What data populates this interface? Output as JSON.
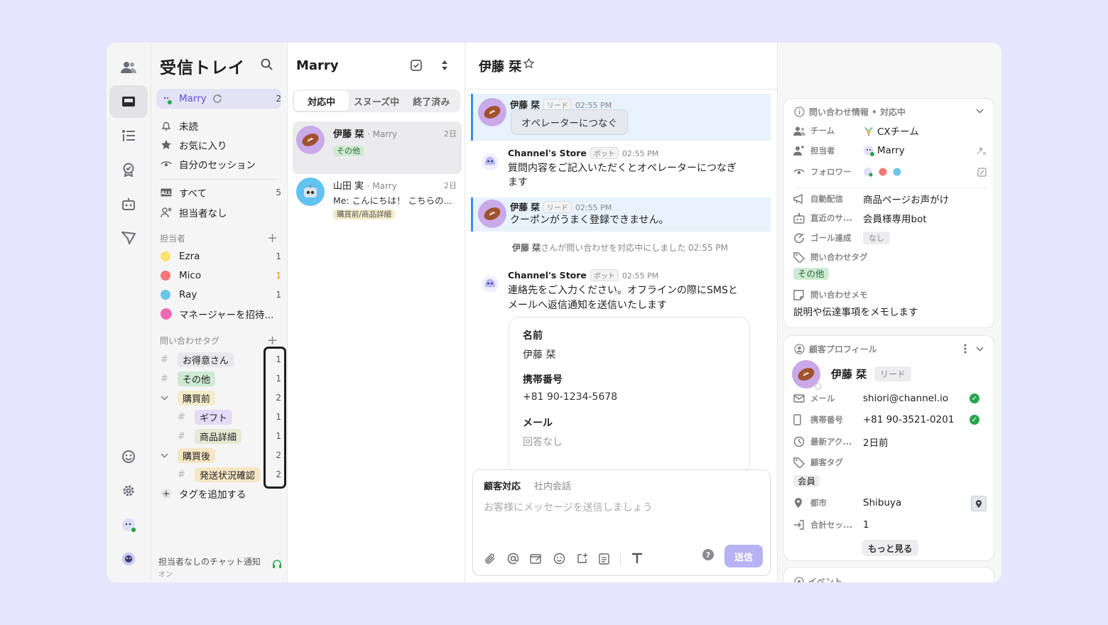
{
  "sidebar": {
    "title": "受信トレイ",
    "me": {
      "name": "Marry",
      "count": "2"
    },
    "items": [
      {
        "label": "未読",
        "count": ""
      },
      {
        "label": "お気に入り",
        "count": ""
      },
      {
        "label": "自分のセッション",
        "count": ""
      }
    ],
    "all": {
      "label": "すべて",
      "count": "5"
    },
    "unassigned": {
      "label": "担当者なし"
    },
    "assignee_section": "担当者",
    "assignees": [
      {
        "name": "Ezra",
        "count": "1"
      },
      {
        "name": "Mico",
        "count": "1"
      },
      {
        "name": "Ray",
        "count": "1"
      }
    ],
    "invite": "マネージャーを招待...",
    "tag_section": "問い合わせタグ",
    "tags": [
      {
        "label": "お得意さん",
        "count": "1"
      },
      {
        "label": "その他",
        "count": "1"
      },
      {
        "label": "購買前",
        "count": "2"
      },
      {
        "label": "ギフト",
        "count": "1"
      },
      {
        "label": "商品詳細",
        "count": "1"
      },
      {
        "label": "購買後",
        "count": "2"
      },
      {
        "label": "発送状況確認",
        "count": "2"
      }
    ],
    "add_tag": "タグを追加する",
    "notify_label": "担当者なしのチャット通知",
    "notify_state": "オン"
  },
  "chatlist": {
    "title": "Marry",
    "tabs": [
      "対応中",
      "スヌーズ中",
      "終了済み"
    ],
    "chats": [
      {
        "name": "伊藤 栞",
        "assignee": "· Marry",
        "time": "2日",
        "message": "",
        "tag": "その他"
      },
      {
        "name": "山田 実",
        "assignee": "· Marry",
        "time": "2日",
        "message": "Me: こんにちは！ こちらの...",
        "tag": "購買前/商品詳細"
      }
    ]
  },
  "conversation": {
    "title": "伊藤 栞",
    "messages": [
      {
        "name": "伊藤 栞",
        "badge": "リード",
        "time": "02:55 PM",
        "button": "オペレーターにつなぐ"
      },
      {
        "name": "Channel's Store",
        "badge": "ボット",
        "time": "02:55 PM",
        "line1": "質問内容をご記入いただくとオペレーターにつなぎ",
        "line2": "ます"
      },
      {
        "name": "伊藤 栞",
        "badge": "リード",
        "time": "02:55 PM",
        "line1": "クーポンがうまく登録できません。"
      },
      {
        "name": "Channel's Store",
        "badge": "ボット",
        "time": "02:55 PM",
        "line1": "連絡先をご入力ください。オフラインの際にSMSと",
        "line2": "メールへ返信通知を送信いたします"
      }
    ],
    "system": {
      "name": "伊藤 栞",
      "text": "さんが問い合わせを対応中にしました",
      "time": "02:55 PM"
    },
    "form": {
      "name_label": "名前",
      "name_value": "伊藤 栞",
      "phone_label": "携帯番号",
      "phone_value": "+81 90-1234-5678",
      "mail_label": "メール",
      "mail_value": "回答なし"
    },
    "composer": {
      "tab_active": "顧客対応",
      "tab_other": "社内会話",
      "placeholder": "お客様にメッセージを送信しましょう",
      "send": "送信",
      "help": "?"
    }
  },
  "info": {
    "title": "問い合わせ情報 • 対応中",
    "rows": [
      {
        "label": "チーム",
        "value": "CXチーム"
      },
      {
        "label": "担当者",
        "value": "Marry"
      },
      {
        "label": "フォロワー",
        "value": ""
      },
      {
        "label": "自動配信",
        "value": "商品ページお声がけ"
      },
      {
        "label": "直近のサ...",
        "value": "会員様専用bot"
      },
      {
        "label": "ゴール達成",
        "value": "なし"
      },
      {
        "label": "問い合わせタグ",
        "value": "その他"
      },
      {
        "label": "問い合わせメモ",
        "value": "説明や伝達事項をメモします"
      }
    ]
  },
  "profile": {
    "title": "顧客プロフィール",
    "name": "伊藤 栞",
    "badge": "リード",
    "rows": [
      {
        "label": "メール",
        "value": "shiori@channel.io"
      },
      {
        "label": "携帯番号",
        "value": "+81 90-3521-0201"
      },
      {
        "label": "最新アク...",
        "value": "2日前"
      },
      {
        "label": "顧客タグ",
        "value": "会員"
      },
      {
        "label": "都市",
        "value": "Shibuya"
      },
      {
        "label": "合計セッ...",
        "value": "1"
      }
    ],
    "more": "もっと見る"
  },
  "events": {
    "title": "イベント"
  },
  "colors": {
    "accent": "#5b4fd6",
    "highlight": "#e8f2fd",
    "send": "#b7b2f3",
    "online": "#2aa54f"
  }
}
